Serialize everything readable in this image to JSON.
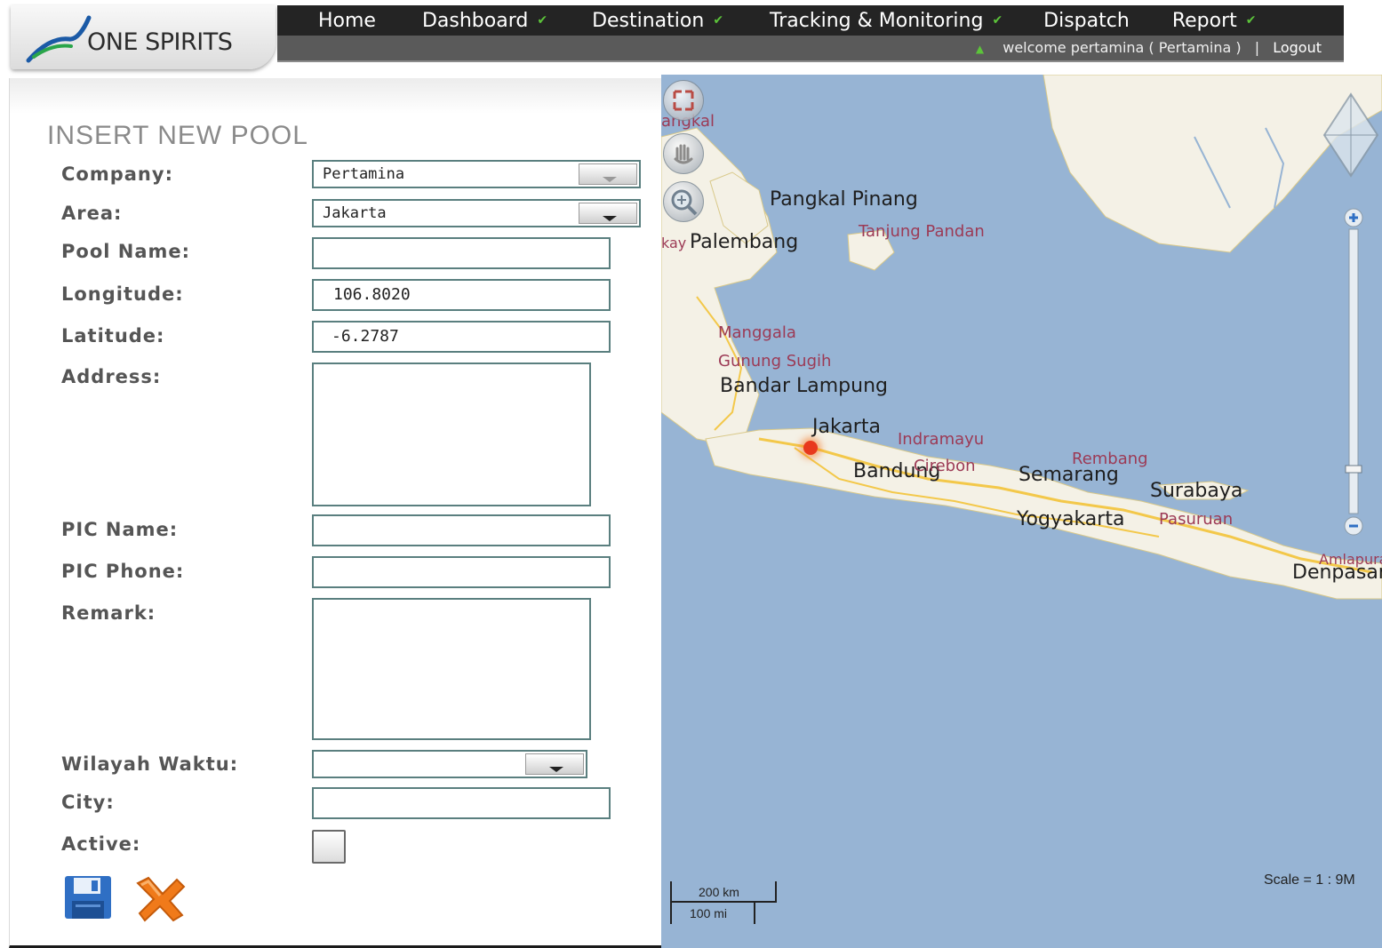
{
  "app": {
    "logo_text": "ONE SPIRITS"
  },
  "menu": [
    {
      "label": "Home",
      "has_dropdown": false
    },
    {
      "label": "Dashboard",
      "has_dropdown": true
    },
    {
      "label": "Destination",
      "has_dropdown": true
    },
    {
      "label": "Tracking & Monitoring",
      "has_dropdown": true
    },
    {
      "label": "Dispatch",
      "has_dropdown": false
    },
    {
      "label": "Report",
      "has_dropdown": true
    }
  ],
  "user": {
    "welcome": "welcome pertamina ( Pertamina )",
    "separator": "|",
    "logout": "Logout"
  },
  "form": {
    "title": "INSERT NEW POOL",
    "labels": {
      "company": "Company:",
      "area": "Area:",
      "pool_name": "Pool Name:",
      "longitude": "Longitude:",
      "latitude": "Latitude:",
      "address": "Address:",
      "pic_name": "PIC Name:",
      "pic_phone": "PIC Phone:",
      "remark": "Remark:",
      "wilayah_waktu": "Wilayah Waktu:",
      "city": "City:",
      "active": "Active:"
    },
    "values": {
      "company": "Pertamina",
      "area": "Jakarta",
      "pool_name": "",
      "longitude": "106.8020",
      "latitude": "-6.2787",
      "address": "",
      "pic_name": "",
      "pic_phone": "",
      "remark": "",
      "wilayah_waktu": "",
      "city": "",
      "active": false
    },
    "icons": {
      "save": "save-icon",
      "cancel": "cancel-icon"
    }
  },
  "map": {
    "labels_main": [
      "Pangkal Pinang",
      "Palembang",
      "Bandar Lampung",
      "Jakarta",
      "Bandung",
      "Semarang",
      "Surabaya",
      "Yogyakarta",
      "Denpasar"
    ],
    "labels_minor": [
      "Tanjung Pandan",
      "Manggala",
      "Gunung Sugih",
      "Indramayu",
      "Cirebon",
      "Rembang",
      "Pasuruan",
      "Amlapura"
    ],
    "labels_cut": [
      "angkal",
      "kay"
    ],
    "scale_text": "Scale = 1 : 9M",
    "scalebar_km": "200 km",
    "scalebar_mi": "100 mi",
    "colors": {
      "sea": "#97b4d4",
      "land": "#f4f1e6",
      "roads": "#f3c84a",
      "marker": "#e8381d"
    }
  },
  "colors": {
    "topbar": "#242424",
    "menu_chevron": "#5cc43a",
    "field_border": "#5a7f7f",
    "label_text": "#555555",
    "save_icon": "#2f6fc4",
    "cancel_icon": "#f07a1a"
  }
}
